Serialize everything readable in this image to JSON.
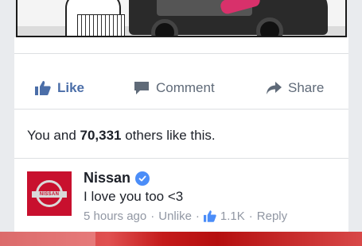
{
  "post": {
    "actions": {
      "like_label": "Like",
      "comment_label": "Comment",
      "share_label": "Share"
    },
    "likes_summary": {
      "prefix": "You and ",
      "count": "70,331",
      "suffix": " others like this."
    }
  },
  "comment": {
    "author": "Nissan",
    "avatar_brand_text": "NISSAN",
    "text": "I love you too <3",
    "time": "5 hours ago",
    "separator": "·",
    "unlike_label": "Unlike",
    "like_count": "1.1K",
    "reply_label": "Reply"
  },
  "colors": {
    "like_blue": "#4b6ea8",
    "verified_blue": "#4b8df8",
    "brand_red": "#c8102e"
  },
  "icons": {
    "like": "thumbs-up-icon",
    "comment": "speech-bubble-icon",
    "share": "share-arrow-icon",
    "verified": "verified-check-icon"
  }
}
